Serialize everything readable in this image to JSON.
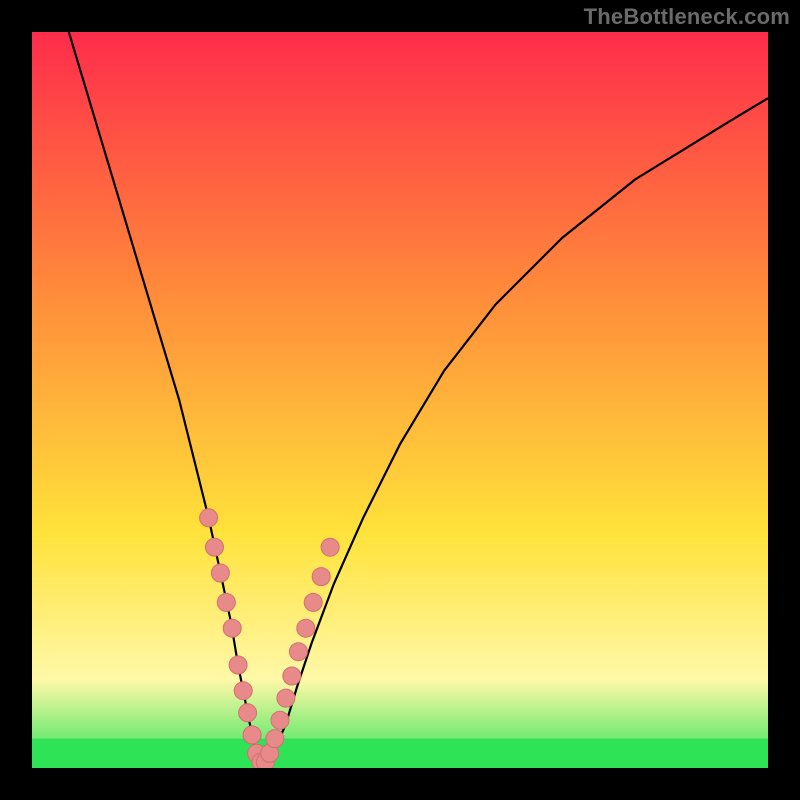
{
  "watermark": "TheBottleneck.com",
  "colors": {
    "frame": "#000000",
    "curve": "#000000",
    "markers_fill": "#e88a8a",
    "markers_stroke": "#d46f6f",
    "green_band": "#2fe357",
    "gradient": {
      "top": "#ff2c4b",
      "mid_orange": "#ff8a3a",
      "mid_yellow": "#ffe23a",
      "pale_yellow": "#fff8a8",
      "green": "#2fe357"
    }
  },
  "chart_data": {
    "type": "line",
    "title": "",
    "xlabel": "",
    "ylabel": "",
    "xlim": [
      0,
      100
    ],
    "ylim": [
      0,
      100
    ],
    "series": [
      {
        "name": "bottleneck-curve",
        "x": [
          5,
          8,
          11,
          14,
          17,
          20,
          22,
          24,
          25.5,
          27,
          28,
          29,
          29.8,
          30.5,
          31.2,
          32,
          33,
          34.5,
          36,
          38,
          41,
          45,
          50,
          56,
          63,
          72,
          82,
          95,
          100
        ],
        "values": [
          100,
          90,
          80,
          70,
          60,
          50,
          42,
          34,
          27,
          20,
          14,
          9,
          5,
          2,
          0.5,
          0.5,
          2.5,
          6,
          11,
          17,
          25,
          34,
          44,
          54,
          63,
          72,
          80,
          88,
          91
        ]
      }
    ],
    "markers": {
      "name": "highlighted-points",
      "x": [
        24.0,
        24.8,
        25.6,
        26.4,
        27.2,
        28.0,
        28.7,
        29.3,
        29.9,
        30.5,
        31.1,
        31.7,
        32.3,
        33.0,
        33.7,
        34.5,
        35.3,
        36.2,
        37.2,
        38.2,
        39.3,
        40.5
      ],
      "values": [
        34.0,
        30.0,
        26.5,
        22.5,
        19.0,
        14.0,
        10.5,
        7.5,
        4.5,
        2.0,
        0.8,
        0.8,
        2.0,
        4.0,
        6.5,
        9.5,
        12.5,
        15.8,
        19.0,
        22.5,
        26.0,
        30.0
      ]
    },
    "green_band": {
      "y0": 0,
      "y1": 4
    }
  }
}
